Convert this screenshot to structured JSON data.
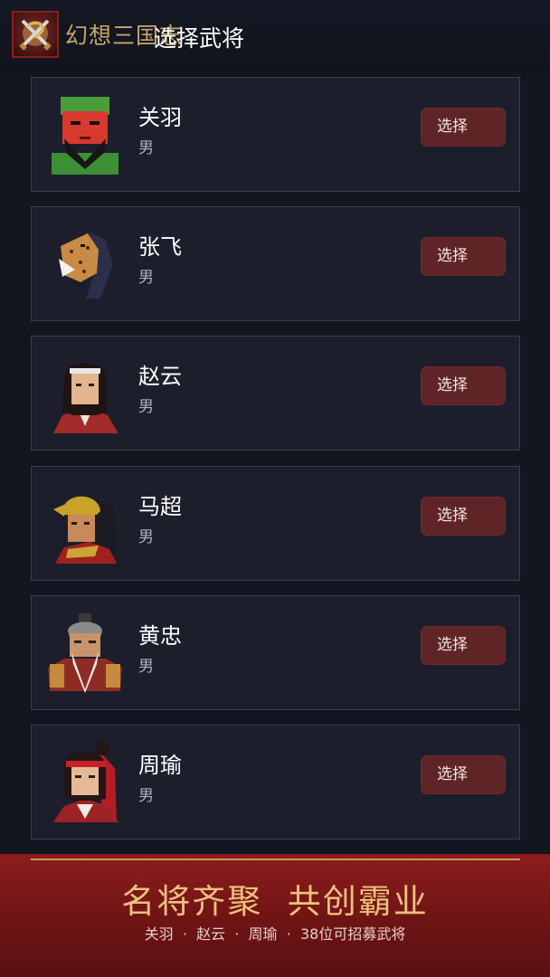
{
  "app": {
    "name": "幻想三国志",
    "page_title": "选择武将",
    "icon": "crossed-swords-dragon-icon"
  },
  "heroes": [
    {
      "name": "关羽",
      "gender": "男",
      "button": "选择",
      "portrait": "guan-yu-portrait"
    },
    {
      "name": "张飞",
      "gender": "男",
      "button": "选择",
      "portrait": "zhang-fei-portrait"
    },
    {
      "name": "赵云",
      "gender": "男",
      "button": "选择",
      "portrait": "zhao-yun-portrait"
    },
    {
      "name": "马超",
      "gender": "男",
      "button": "选择",
      "portrait": "ma-chao-portrait"
    },
    {
      "name": "黄忠",
      "gender": "男",
      "button": "选择",
      "portrait": "huang-zhong-portrait"
    },
    {
      "name": "周瑜",
      "gender": "男",
      "button": "选择",
      "portrait": "zhou-yu-portrait"
    }
  ],
  "banner": {
    "slogan": "名将齐聚  共创霸业",
    "subtitle": "关羽  ·  赵云  ·  周瑜  ·  38位可招募武将"
  },
  "colors": {
    "background": "#121621",
    "card": "#1c1f2b",
    "button": "#5f2426",
    "banner": "#7a1718",
    "gold": "#ecc27c"
  }
}
